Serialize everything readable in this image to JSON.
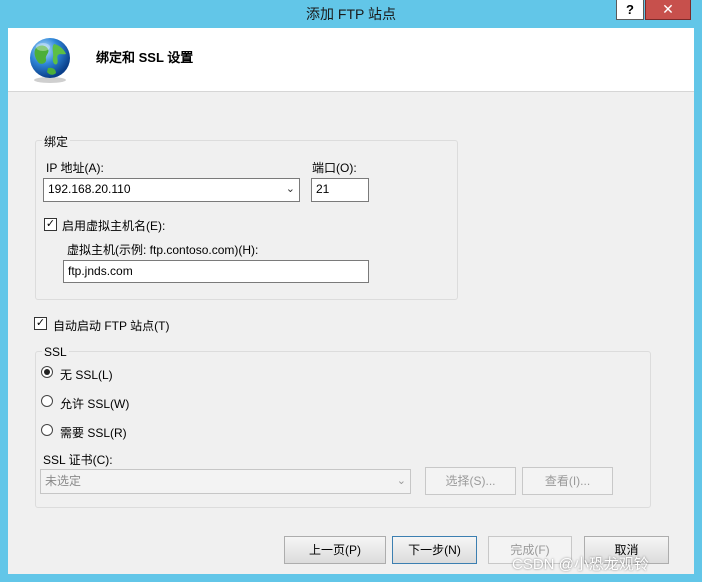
{
  "window": {
    "title": "添加 FTP 站点",
    "help_label": "?",
    "close_label": "✕"
  },
  "header": {
    "title": "绑定和 SSL 设置",
    "icon": "globe-icon"
  },
  "binding": {
    "group_label": "绑定",
    "ip_label": "IP 地址(A):",
    "ip_value": "192.168.20.110",
    "port_label": "端口(O):",
    "port_value": "21",
    "vhost_checkbox_label": "启用虚拟主机名(E):",
    "vhost_checked": true,
    "vhost_hint": "虚拟主机(示例: ftp.contoso.com)(H):",
    "vhost_value": "ftp.jnds.com"
  },
  "autostart": {
    "label": "自动启动 FTP 站点(T)",
    "checked": true
  },
  "ssl": {
    "group_label": "SSL",
    "options": [
      "无 SSL(L)",
      "允许 SSL(W)",
      "需要 SSL(R)"
    ],
    "selected_index": 0,
    "cert_label": "SSL 证书(C):",
    "cert_value": "未选定",
    "select_button": "选择(S)...",
    "view_button": "查看(I)..."
  },
  "footer": {
    "prev_button": "上一页(P)",
    "next_button": "下一步(N)",
    "finish_button": "完成(F)",
    "cancel_button": "取消"
  },
  "watermark": "CSDN @小恐龙观铃",
  "colors": {
    "titlebar": "#62c6e8",
    "close": "#c7504c",
    "client": "#f0f0f0"
  }
}
